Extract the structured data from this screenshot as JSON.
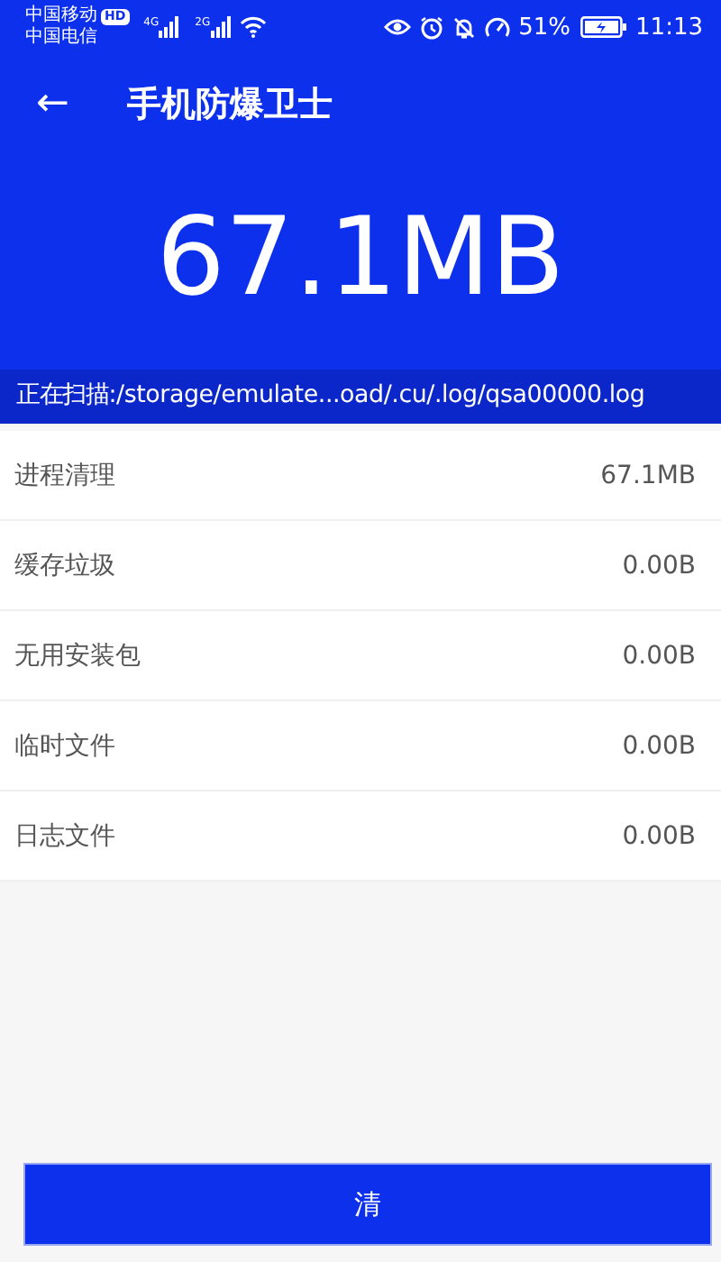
{
  "status_bar": {
    "carriers": [
      "中国移动",
      "中国电信"
    ],
    "hd_badge": "HD",
    "network_labels": [
      "4G",
      "2G"
    ],
    "battery_percent": "51%",
    "time": "11:13"
  },
  "header": {
    "back": "←",
    "title": "手机防爆卫士"
  },
  "total_size": "67.1MB",
  "scan_status": "正在扫描:/storage/emulate...oad/.cu/.log/qsa00000.log",
  "categories": [
    {
      "name": "进程清理",
      "size": "67.1MB"
    },
    {
      "name": "缓存垃圾",
      "size": "0.00B"
    },
    {
      "name": "无用安装包",
      "size": "0.00B"
    },
    {
      "name": "临时文件",
      "size": "0.00B"
    },
    {
      "name": "日志文件",
      "size": "0.00B"
    }
  ],
  "action_button": "清"
}
